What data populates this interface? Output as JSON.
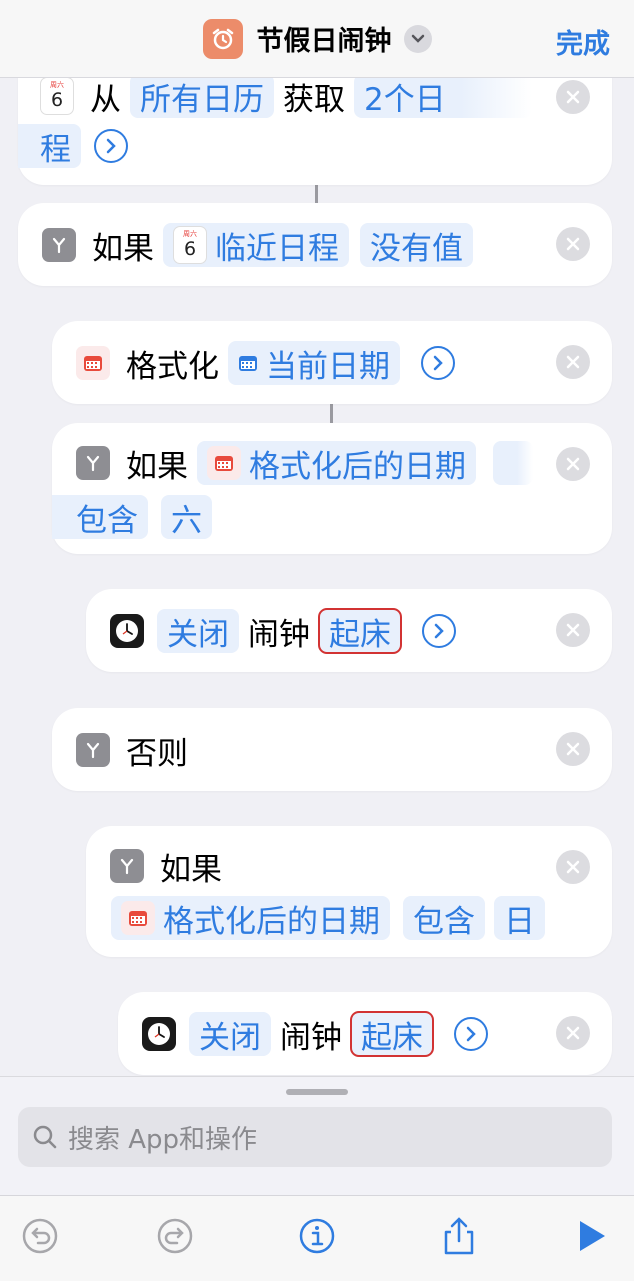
{
  "header": {
    "title": "节假日闹钟",
    "done_label": "完成"
  },
  "blocks": {
    "get_events": {
      "word1": "从",
      "source": "所有日历",
      "word2": "获取",
      "count": "2个日",
      "count_cont": "程",
      "calendar_weekday": "周六",
      "calendar_day": "6"
    },
    "if1": {
      "keyword": "如果",
      "var": "临近日程",
      "cond": "没有值",
      "calendar_weekday": "周六",
      "calendar_day": "6"
    },
    "format": {
      "keyword": "格式化",
      "var": "当前日期"
    },
    "if2": {
      "keyword": "如果",
      "var": "格式化后的日期",
      "cond": "包含",
      "value": "六"
    },
    "alarm1": {
      "action": "关闭",
      "word": "闹钟",
      "alarm": "起床"
    },
    "otherwise": {
      "keyword": "否则"
    },
    "if3": {
      "keyword": "如果",
      "var": "格式化后的日期",
      "cond": "包含",
      "value": "日"
    },
    "alarm2": {
      "action": "关闭",
      "word": "闹钟",
      "alarm": "起床"
    }
  },
  "search": {
    "placeholder": "搜索 App和操作"
  },
  "toolbar": {
    "items": [
      "undo-icon",
      "redo-icon",
      "info-icon",
      "share-icon",
      "play-icon"
    ]
  },
  "colors": {
    "accent": "#2f7ce0",
    "highlight_box": "#d23333",
    "app_icon": "#ec8c6a"
  }
}
